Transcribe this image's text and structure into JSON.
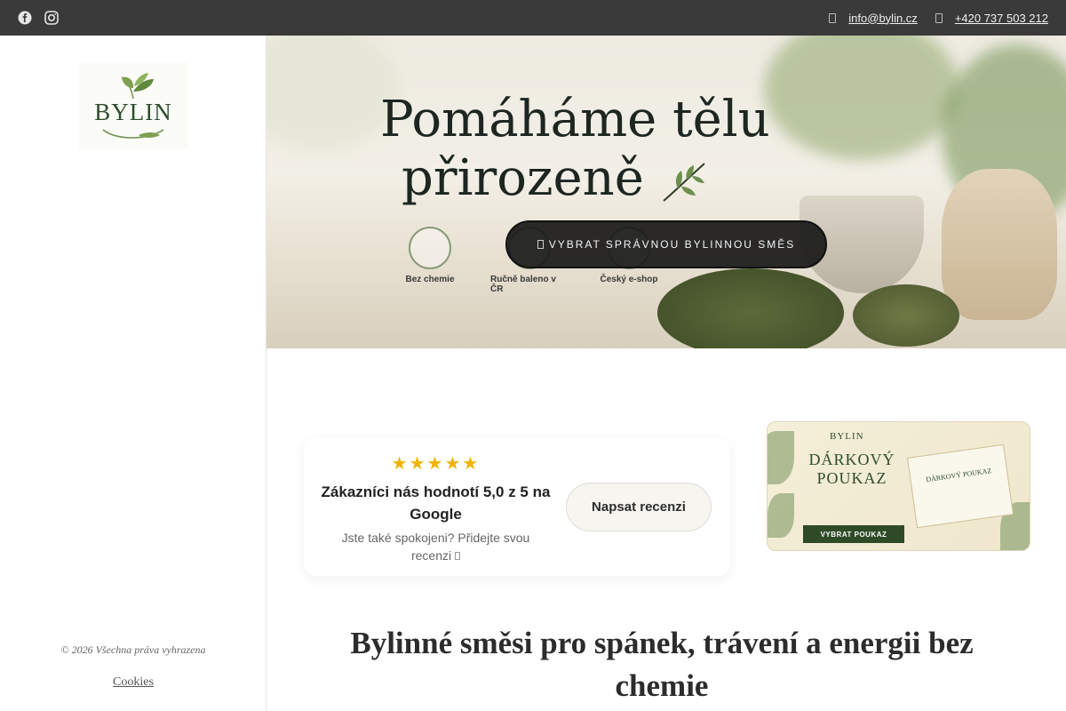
{
  "topbar": {
    "social": [
      {
        "icon": "facebook-icon"
      },
      {
        "icon": "instagram-icon"
      }
    ],
    "email": "info@bylin.cz",
    "phone": "+420 737 503 212"
  },
  "sidebar": {
    "logo_text": "BYLIN",
    "copyright": "© 2026 Všechna práva vyhrazena",
    "cookies": "Cookies"
  },
  "hero": {
    "title_line1": "Pomáháme tělu",
    "title_line2": "přirozeně",
    "badges": [
      "Bez chemie",
      "Ručně baleno v ČR",
      "Český e-shop"
    ],
    "cta_label": "VYBRAT SPRÁVNOU BYLINNOU SMĚS"
  },
  "review": {
    "stars": "★★★★★",
    "title": "Zákazníci nás hodnotí 5,0 z 5 na Google",
    "subtitle": "Jste také spokojeni? Přidejte svou recenzi",
    "button": "Napsat recenzi"
  },
  "voucher": {
    "logo": "BYLIN",
    "title": "DÁRKOVÝ POUKAZ",
    "card_title": "DÁRKOVÝ POUKAZ",
    "button": "VYBRAT POUKAZ"
  },
  "section": {
    "heading": "Bylinné směsi pro spánek, trávení a energii bez chemie"
  },
  "colors": {
    "topbar": "#3a3a3a",
    "brand_green": "#2d4d2b",
    "star": "#f0b400"
  }
}
